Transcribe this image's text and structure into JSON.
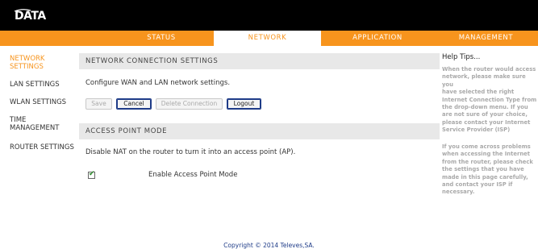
{
  "brand": {
    "logo_text": "DATA",
    "logo_color": "#ffffff"
  },
  "nav": {
    "status": "STATUS",
    "network": "NETWORK",
    "application": "APPLICATION",
    "management": "MANAGEMENT",
    "active": "NETWORK"
  },
  "sidebar": {
    "items": [
      {
        "label": "NETWORK\nSETTINGS",
        "active": true
      },
      {
        "label": "LAN SETTINGS"
      },
      {
        "label": "WLAN SETTINGS"
      },
      {
        "label": "TIME\nMANAGEMENT"
      },
      {
        "label": "ROUTER SETTINGS"
      }
    ]
  },
  "main": {
    "connection": {
      "header": "NETWORK CONNECTION SETTINGS",
      "description": "Configure WAN and LAN network settings.",
      "buttons": {
        "save": "Save",
        "cancel": "Cancel",
        "delete": "Delete Connection",
        "logout": "Logout"
      }
    },
    "ap_mode": {
      "header": "ACCESS POINT MODE",
      "description": "Disable NAT on the router to turn it into an access point (AP).",
      "checkbox_label": "Enable Access Point Mode",
      "checked": true
    }
  },
  "help": {
    "title": "Help Tips...",
    "paragraph1": "When the router would access\nnetwork, please make sure you\nhave selected the right\nInternet Connection Type from\nthe drop-down menu. If you\nare not sure of your choice,\nplease contact your Internet\nService Provider (ISP)",
    "paragraph2": "If you come across problems\nwhen accessing the Internet\nfrom the router, please check\nthe settings that you have\nmade in this page carefully,\nand contact your ISP if\nnecessary."
  },
  "footer": {
    "copyright": "Copyright © 2014 Televes,SA."
  },
  "colors": {
    "accent": "#f7941d",
    "topbar": "#000000",
    "footer_link": "#1f3c88"
  }
}
